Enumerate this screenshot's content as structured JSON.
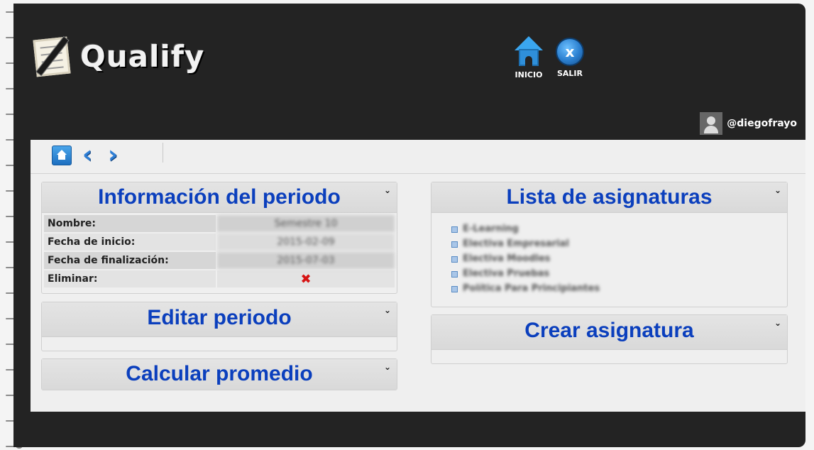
{
  "app": {
    "logo_text": "Qualify"
  },
  "header": {
    "nav": [
      {
        "label": "INICIO",
        "icon": "home-icon"
      },
      {
        "label": "SALIR",
        "icon": "exit-icon",
        "glyph": "x"
      }
    ],
    "user": {
      "username": "@diegofrayo",
      "icon": "user-avatar-icon"
    }
  },
  "toolbar": {
    "icons": [
      "home-icon",
      "chevron-left-icon",
      "chevron-right-icon"
    ],
    "back_glyph": "‹",
    "forward_glyph": "›"
  },
  "periodo": {
    "title": "Información del periodo",
    "rows": [
      {
        "label": "Nombre:",
        "value": "Semestre 10"
      },
      {
        "label": "Fecha de inicio:",
        "value": "2015-02-09"
      },
      {
        "label": "Fecha de finalización:",
        "value": "2015-07-03"
      },
      {
        "label": "Eliminar:",
        "value": "✖"
      }
    ]
  },
  "editar": {
    "title": "Editar periodo"
  },
  "calcular": {
    "title": "Calcular promedio"
  },
  "asignaturas": {
    "title": "Lista de asignaturas",
    "items": [
      "E-Learning",
      "Electiva Empresarial",
      "Electiva Moodles",
      "Electiva Pruebas",
      "Política Para Principiantes"
    ]
  },
  "crear": {
    "title": "Crear asignatura"
  },
  "collapse_glyph": "⌄",
  "colors": {
    "frame": "#232323",
    "content_bg": "#efefef",
    "title_blue": "#0b3fbd",
    "accent_blue": "#2f8fd9",
    "delete_red": "#d61414"
  }
}
